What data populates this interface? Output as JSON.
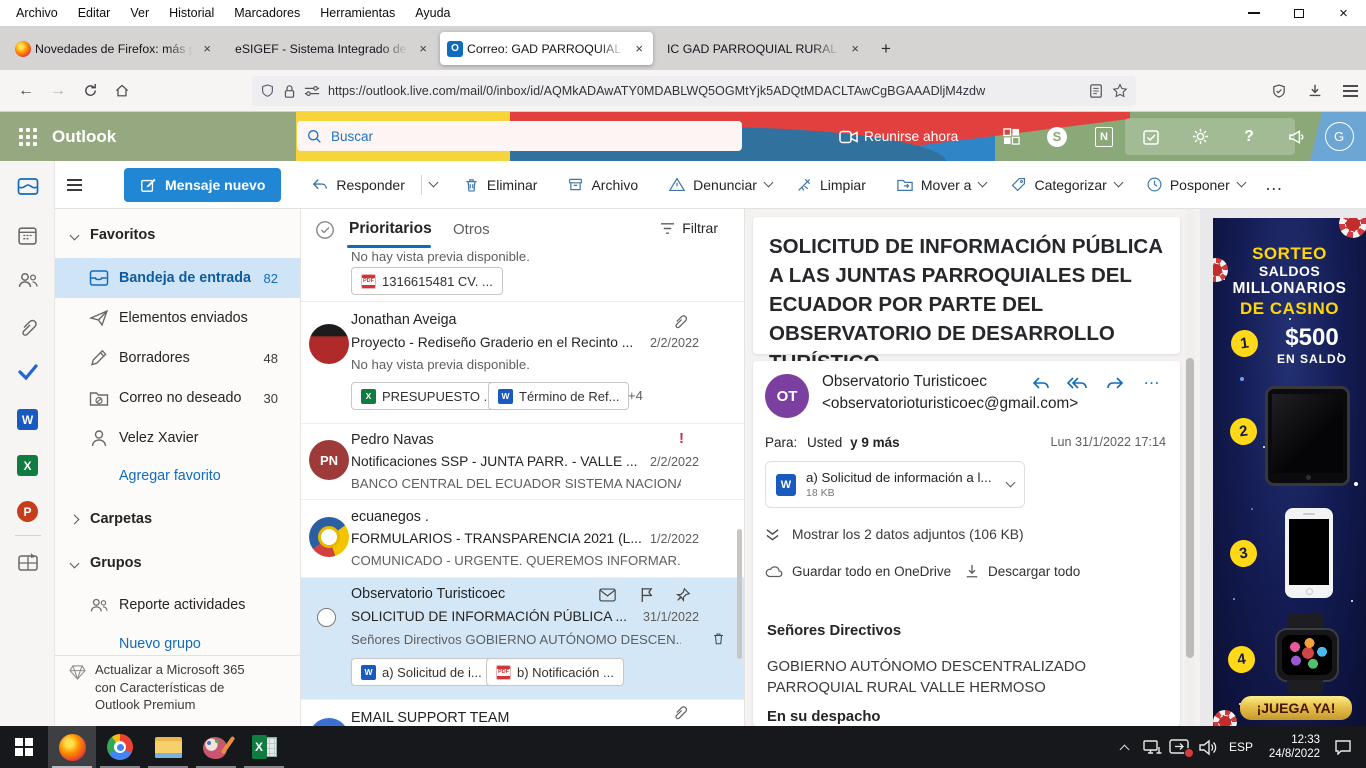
{
  "icons": {
    "close_x": "×",
    "more_h": "…",
    "plus": "+",
    "letters": {
      "outlook": "O",
      "word": "W",
      "excel": "X",
      "powerpoint": "P",
      "skype": "S",
      "onenote": "N",
      "pdf": "PDF",
      "question": "?"
    },
    "importance_high": "!"
  },
  "browser": {
    "menu": {
      "archivo": "Archivo",
      "editar": "Editar",
      "ver": "Ver",
      "historial": "Historial",
      "marcadores": "Marcadores",
      "herramientas": "Herramientas",
      "ayuda": "Ayuda"
    },
    "tabs": {
      "tab1": "Novedades de Firefox: más priva",
      "tab2": "eSIGEF - Sistema Integrado de Gestió",
      "tab3": "Correo: GAD PARROQUIAL VALL",
      "tab4": "IC GAD PARROQUIAL RURAL VALLE"
    },
    "url": "https://outlook.live.com/mail/0/inbox/id/AQMkADAwATY0MDABLWQ5OGMtYjk5ADQtMDACLTAwCgBGAAADljM4zdw"
  },
  "outlook": {
    "brand": "Outlook",
    "search_placeholder": "Buscar",
    "meet_now": "Reunirse ahora",
    "avatar_initial": "G",
    "toolbar": {
      "new_message": "Mensaje nuevo",
      "reply": "Responder",
      "delete": "Eliminar",
      "archive": "Archivo",
      "report": "Denunciar",
      "sweep": "Limpiar",
      "move": "Mover a",
      "categorize": "Categorizar",
      "snooze": "Posponer"
    },
    "sidebar": {
      "favorites": "Favoritos",
      "inbox": "Bandeja de entrada",
      "inbox_count": "82",
      "sent": "Elementos enviados",
      "drafts": "Borradores",
      "drafts_count": "48",
      "junk": "Correo no deseado",
      "junk_count": "30",
      "contact": "Velez Xavier",
      "add_favorite": "Agregar favorito",
      "folders": "Carpetas",
      "groups": "Grupos",
      "group1": "Reporte actividades",
      "new_group": "Nuevo grupo",
      "premium_line1": "Actualizar a Microsoft 365",
      "premium_line2": "con Características de",
      "premium_line3": "Outlook Premium"
    },
    "list": {
      "tab_focused": "Prioritarios",
      "tab_other": "Otros",
      "filter": "Filtrar",
      "top_preview": "No hay vista previa disponible.",
      "top_chip": "1316615481 CV. ...",
      "item1": {
        "sender": "Jonathan Aveiga",
        "subject": "Proyecto - Rediseño Graderio en el Recinto ...",
        "date": "2/2/2022",
        "preview": "No hay vista previa disponible.",
        "chip1": "PRESUPUESTO ...",
        "chip2": "Término de Ref...",
        "more_chips": "+4"
      },
      "item2": {
        "sender": "Pedro Navas",
        "initials": "PN",
        "subject": "Notificaciones SSP - JUNTA PARR. - VALLE ...",
        "date": "2/2/2022",
        "preview": "BANCO CENTRAL DEL ECUADOR SISTEMA NACIONA..."
      },
      "item3": {
        "sender": "ecuanegos .",
        "subject": "FORMULARIOS - TRANSPARENCIA 2021 (L...",
        "date": "1/2/2022",
        "preview": "COMUNICADO - URGENTE. QUEREMOS INFORMAR..."
      },
      "item4": {
        "sender": "Observatorio Turisticoec",
        "subject": "SOLICITUD DE INFORMACIÓN PÚBLICA ...",
        "date": "31/1/2022",
        "preview": "Señores Directivos GOBIERNO AUTÓNOMO DESCEN...",
        "chip1": "a) Solicitud de i...",
        "chip2": "b) Notificación ..."
      },
      "item5": {
        "sender": "EMAIL SUPPORT TEAM"
      }
    },
    "reader": {
      "subject": "SOLICITUD DE INFORMACIÓN PÚBLICA A LAS JUNTAS PARROQUIALES DEL ECUADOR POR PARTE DEL OBSERVATORIO DE DESARROLLO TURÍSTICO",
      "sender_name": "Observatorio Turisticoec",
      "sender_email": "<observatorioturisticoec@gmail.com>",
      "sender_initials": "OT",
      "to_label": "Para:",
      "to_primary": "Usted",
      "to_more": "y 9 más",
      "datetime": "Lun 31/1/2022 17:14",
      "attachment_name": "a) Solicitud de información a l...",
      "attachment_size": "18 KB",
      "show_attachments": "Mostrar los 2 datos adjuntos (106 KB)",
      "save_onedrive": "Guardar todo en OneDrive",
      "download_all": "Descargar todo",
      "body_greeting": "Señores Directivos",
      "body_line1": "GOBIERNO AUTÓNOMO DESCENTRALIZADO PARROQUIAL RURAL VALLE HERMOSO",
      "body_line2": "En su despacho"
    }
  },
  "ad": {
    "t1": "SORTEO",
    "t2": "SALDOS",
    "t3": "MILLONARIOS",
    "t4": "DE CASINO",
    "n1": "1",
    "amount": "$500",
    "amount_label": "EN SALDO",
    "n2": "2",
    "n3": "3",
    "n4": "4",
    "cta": "¡JUEGA YA!"
  },
  "taskbar": {
    "lang": "ESP",
    "time": "12:33",
    "date": "24/8/2022"
  }
}
